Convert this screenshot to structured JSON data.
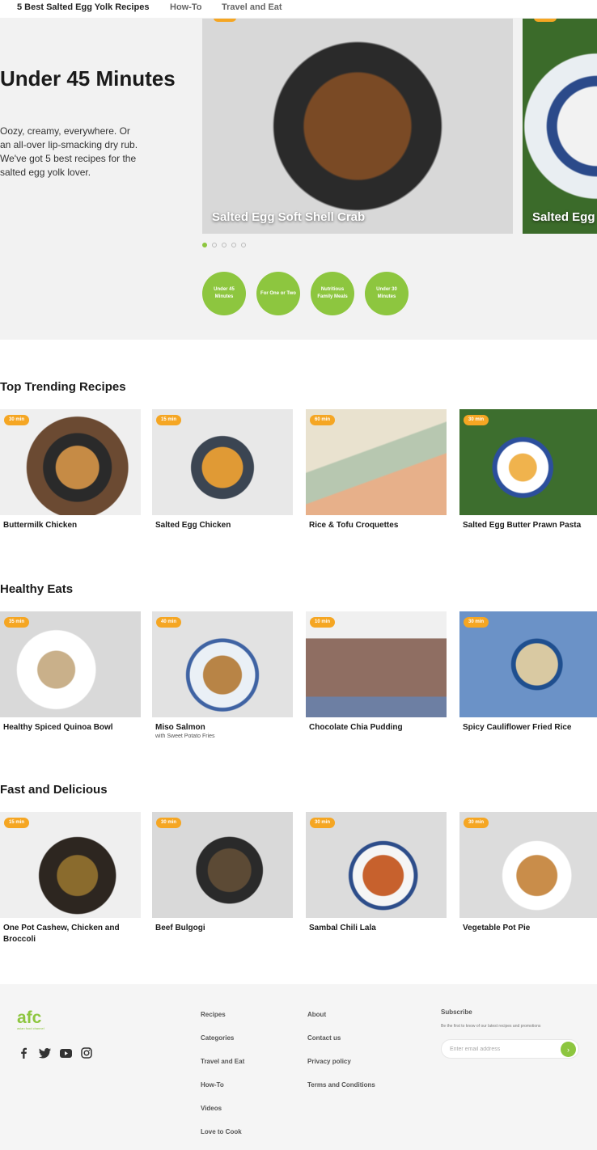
{
  "nav": {
    "items": [
      "5 Best Salted Egg Yolk Recipes",
      "How-To",
      "Travel and Eat"
    ]
  },
  "hero": {
    "title": "Under 45 Minutes",
    "description": "Oozy, creamy, everywhere. Or an all-over lip-smacking dry rub. We've got 5 best recipes for the salted egg yolk lover.",
    "slides": [
      "Salted Egg Soft Shell Crab",
      "Salted Egg"
    ],
    "slide_count": 5,
    "active_slide": 1,
    "categories": [
      "Under 45 Minutes",
      "For One or Two",
      "Nutritious Family Meals",
      "Under 30 Minutes"
    ]
  },
  "sections": [
    {
      "title": "Top Trending Recipes",
      "cards": [
        {
          "time": "30 min",
          "title": "Buttermilk Chicken",
          "subtitle": ""
        },
        {
          "time": "15 min",
          "title": "Salted Egg Chicken",
          "subtitle": ""
        },
        {
          "time": "60 min",
          "title": "Rice & Tofu Croquettes",
          "subtitle": ""
        },
        {
          "time": "30 min",
          "title": "Salted Egg Butter Prawn Pasta",
          "subtitle": ""
        }
      ]
    },
    {
      "title": "Healthy Eats",
      "cards": [
        {
          "time": "35 min",
          "title": "Healthy Spiced Quinoa Bowl",
          "subtitle": ""
        },
        {
          "time": "40 min",
          "title": "Miso Salmon",
          "subtitle": "with Sweet Potato Fries"
        },
        {
          "time": "10 min",
          "title": "Chocolate Chia Pudding",
          "subtitle": ""
        },
        {
          "time": "30 min",
          "title": "Spicy Cauliflower Fried Rice",
          "subtitle": ""
        }
      ]
    },
    {
      "title": "Fast and Delicious",
      "cards": [
        {
          "time": "15 min",
          "title": "One Pot Cashew, Chicken and Broccoli",
          "subtitle": ""
        },
        {
          "time": "30 min",
          "title": "Beef Bulgogi",
          "subtitle": ""
        },
        {
          "time": "30 min",
          "title": "Sambal Chili Lala",
          "subtitle": ""
        },
        {
          "time": "30 min",
          "title": "Vegetable Pot Pie",
          "subtitle": ""
        }
      ]
    }
  ],
  "footer": {
    "logo": "afc",
    "logo_sub": "asian food channel",
    "socials": [
      "facebook-icon",
      "twitter-icon",
      "youtube-icon",
      "instagram-icon"
    ],
    "col1": [
      "Recipes",
      "Categories",
      "Travel and Eat",
      "How-To",
      "Videos",
      "Love to Cook"
    ],
    "col2": [
      "About",
      "Contact us",
      "Privacy policy",
      "Terms and Conditions"
    ],
    "subscribe": {
      "title": "Subscribe",
      "description": "Be the first to know of our latest recipes and promotions",
      "placeholder": "Enter email address",
      "button": "›"
    }
  },
  "colors": {
    "accent": "#8dc63f",
    "badge": "#f5a623",
    "hero_bg": "#f2f2f2",
    "footer_bg": "#f5f5f5"
  }
}
